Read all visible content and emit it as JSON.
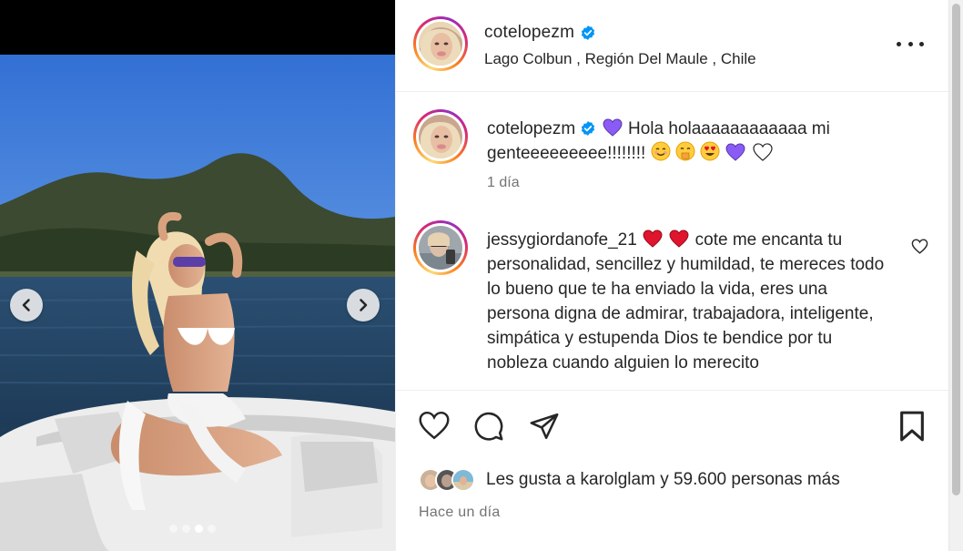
{
  "post": {
    "username": "cotelopezm",
    "verified": true,
    "location": "Lago Colbun , Región Del Maule , Chile",
    "caption_text": "Hola holaaaaaaaaaaaa mi genteeeeeeeee!!!!!!!!",
    "caption_time": "1 día",
    "post_time": "Hace un día"
  },
  "carousel": {
    "slide_count": 4,
    "active_index": 2
  },
  "comment": {
    "username": "jessygiordanofe_21",
    "text": "cote me encanta tu personalidad, sencillez y humildad, te mereces todo lo bueno que te ha enviado la vida, eres una persona digna de admirar, trabajadora, inteligente, simpática y estupenda Dios te bendice por tu nobleza cuando alguien lo merecito"
  },
  "likes": {
    "prefix": "Les gusta a",
    "liked_by": "karolglam",
    "connector": "y",
    "count": "59.600",
    "suffix": "personas más"
  },
  "icons": {
    "verified": "verified-badge-icon",
    "more": "more-options-icon",
    "like": "heart-icon",
    "comment": "comment-icon",
    "share": "send-icon",
    "save": "bookmark-icon",
    "prev": "chevron-left-icon",
    "next": "chevron-right-icon"
  },
  "colors": {
    "verified": "#0095f6",
    "text": "#262626",
    "muted": "#737373",
    "purple_heart": "#8a5cf5",
    "red_heart": "#e0142c"
  }
}
